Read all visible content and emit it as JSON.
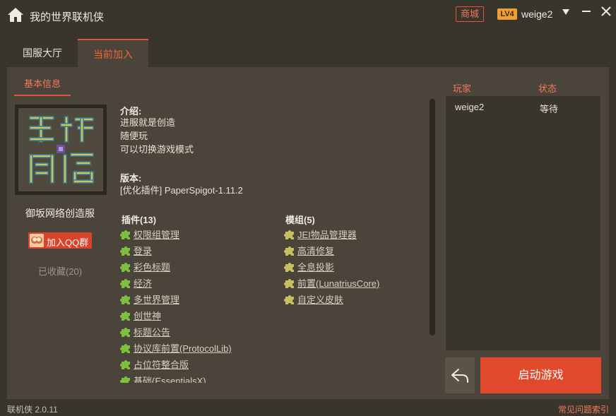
{
  "window": {
    "title": "我的世界联机侠",
    "shop_label": "商城",
    "level": "LV4",
    "username": "weige2"
  },
  "tabs": [
    {
      "label": "国服大厅",
      "active": false
    },
    {
      "label": "当前加入",
      "active": true
    }
  ],
  "server": {
    "basic_info_tab": "基本信息",
    "name": "御坂网络创造服",
    "qq_button": "加入QQ群",
    "favorites": "已收藏(20)",
    "intro_title": "介绍:",
    "intro_lines": [
      "进服就是创造",
      "随便玩",
      "可以切换游戏模式"
    ],
    "version_title": "版本:",
    "version_value": "[优化插件] PaperSpigot-1.11.2",
    "plugins_title": "插件(13)",
    "plugins": [
      "权限组管理",
      "登录",
      "彩色标题",
      "经济",
      "多世界管理",
      "创世神",
      "标题公告",
      "协议库前置(ProtocolLib)",
      "占位符整合版",
      "基础(EssentialsX)"
    ],
    "mods_title": "模组(5)",
    "mods": [
      "JEI物品管理器",
      "高清修复",
      "全息投影",
      "前置(LunatriusCore)",
      "自定义皮肤"
    ]
  },
  "players": {
    "col_player": "玩家",
    "col_status": "状态",
    "rows": [
      {
        "name": "weige2",
        "status": "等待"
      }
    ]
  },
  "actions": {
    "start_button": "启动游戏"
  },
  "footer": {
    "version": "联机侠 2.0.11",
    "faq": "常见问题索引"
  },
  "colors": {
    "accent": "#e0492c",
    "background": "#3a352c",
    "panel": "#4a443a",
    "level_badge": "#f0a030",
    "puzzle_green": "#7fbf3f",
    "puzzle_yellow": "#c8c060"
  },
  "icons": {
    "home": "home-icon",
    "dropdown": "chevron-down-icon",
    "minimize": "minimize-icon",
    "close": "close-icon",
    "plugin": "puzzle-piece-icon",
    "back": "reply-arrow-icon",
    "qq": "qq-icon"
  }
}
